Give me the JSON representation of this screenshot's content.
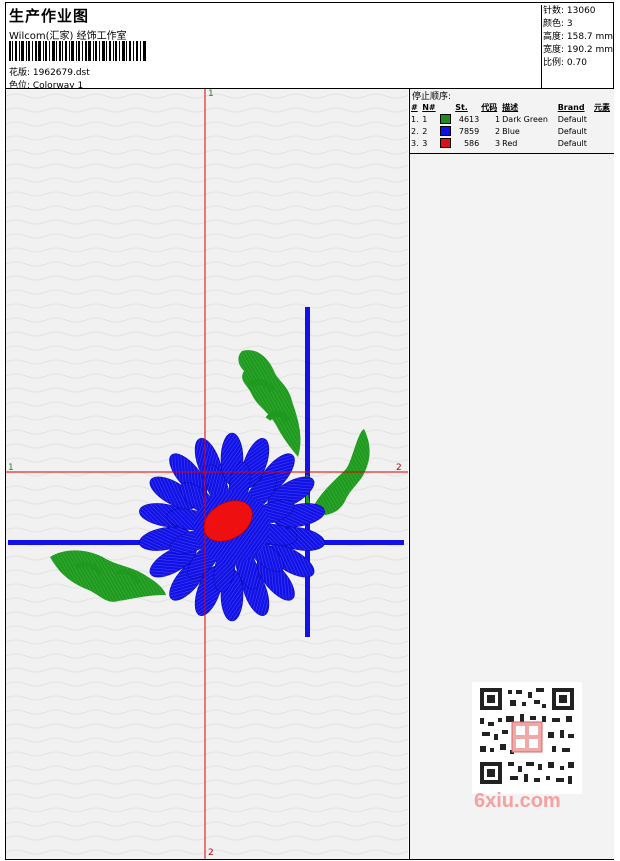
{
  "header": {
    "title": "生产作业图",
    "subtitle": "Wilcom(汇家) 经饰工作室",
    "file_label": "花版: 1962679.dst",
    "colorway_label": "色位: Colorway 1"
  },
  "stats": {
    "stitches": "针数: 13060",
    "colors": "颜色: 3",
    "height": "高度: 158.7 mm",
    "width": "宽度: 190.2 mm",
    "scale": "比例: 0.70"
  },
  "stop_sequence": {
    "title": "停止顺序:",
    "headers": [
      "#",
      "N#",
      "St.",
      "代码",
      "描述",
      "Brand",
      "元素"
    ],
    "rows": [
      {
        "idx": "1.",
        "n": "1",
        "color": "#1f8a1f",
        "st": "4613",
        "code": "1",
        "desc": "Dark Green",
        "brand": "Default"
      },
      {
        "idx": "2.",
        "n": "2",
        "color": "#1010e0",
        "st": "7859",
        "code": "2",
        "desc": "Blue",
        "brand": "Default"
      },
      {
        "idx": "3.",
        "n": "3",
        "color": "#e01010",
        "st": "586",
        "code": "3",
        "desc": "Red",
        "brand": "Default"
      }
    ]
  },
  "axes": {
    "v_top": "1",
    "v_bottom": "2",
    "h_left": "1",
    "h_right": "2"
  },
  "watermark": "6xiu.com",
  "colors": {
    "green": "#1f9a1f",
    "blue": "#1212e8",
    "red": "#ee1010",
    "guide": "#e00000"
  }
}
